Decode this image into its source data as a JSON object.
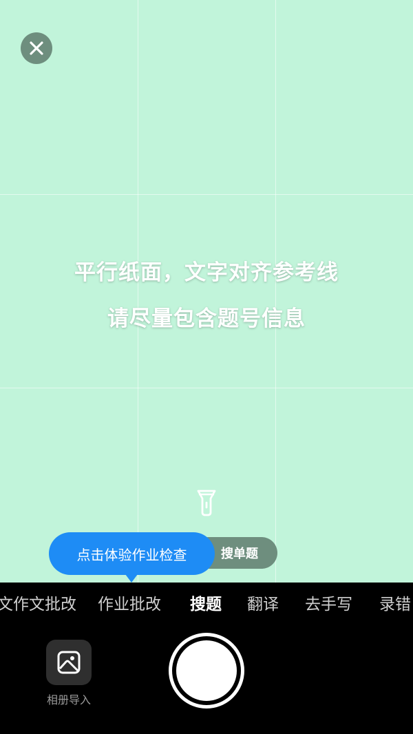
{
  "camera": {
    "hint_line1": "平行纸面，文字对齐参考线",
    "hint_line2": "请尽量包含题号信息",
    "close_icon": "close-icon",
    "flash_icon": "flashlight-icon"
  },
  "tooltip": {
    "text": "点击体验作业检查"
  },
  "mode_pill": {
    "label": "搜单题"
  },
  "tabs": [
    {
      "label": "文作文批改",
      "active": false
    },
    {
      "label": "作业批改",
      "active": false
    },
    {
      "label": "搜题",
      "active": true
    },
    {
      "label": "翻译",
      "active": false
    },
    {
      "label": "去手写",
      "active": false
    },
    {
      "label": "录错",
      "active": false
    }
  ],
  "album": {
    "label": "相册导入",
    "icon": "image-icon"
  },
  "shutter": {
    "icon": "shutter-button"
  },
  "colors": {
    "viewfinder_bg": "#c1f4da",
    "accent_blue": "#1e8cf5",
    "pill_gray_green": "#6e8e7e",
    "bottom_bar_bg": "#000000"
  }
}
